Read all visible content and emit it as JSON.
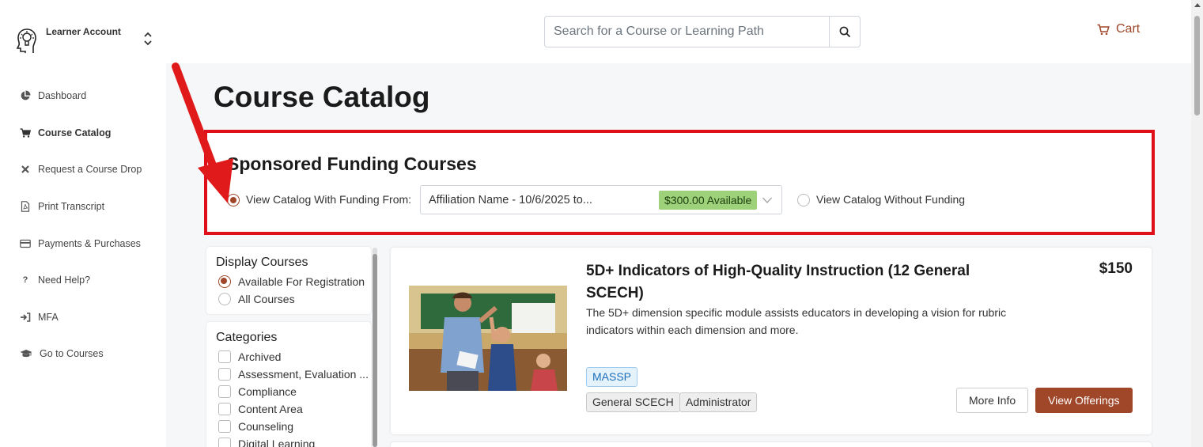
{
  "sidebar": {
    "account_label": "Learner Account",
    "items": [
      {
        "label": "Dashboard",
        "icon": "pie-chart-icon"
      },
      {
        "label": "Course Catalog",
        "icon": "cart-icon",
        "active": true
      },
      {
        "label": "Request a Course Drop",
        "icon": "x-icon"
      },
      {
        "label": "Print Transcript",
        "icon": "pdf-file-icon"
      },
      {
        "label": "Payments & Purchases",
        "icon": "credit-card-icon"
      },
      {
        "label": "Need Help?",
        "icon": "question-icon"
      },
      {
        "label": "MFA",
        "icon": "sign-in-icon"
      },
      {
        "label": "Go to Courses",
        "icon": "graduation-cap-icon"
      }
    ]
  },
  "header": {
    "search_placeholder": "Search for a Course or Learning Path",
    "cart_label": "Cart"
  },
  "page": {
    "title": "Course Catalog"
  },
  "funding": {
    "title": "Sponsored Funding Courses",
    "with_funding_label": "View Catalog With Funding From:",
    "selected_affiliation": "Affiliation Name - 10/6/2025 to...",
    "available_badge": "$300.00 Available",
    "without_funding_label": "View Catalog Without Funding",
    "with_funding_selected": true
  },
  "filters": {
    "display": {
      "title": "Display Courses",
      "options": [
        {
          "label": "Available For Registration",
          "selected": true
        },
        {
          "label": "All Courses",
          "selected": false
        }
      ]
    },
    "categories": {
      "title": "Categories",
      "items": [
        "Archived",
        "Assessment, Evaluation ...",
        "Compliance",
        "Content Area",
        "Counseling",
        "Digital Learning"
      ]
    }
  },
  "course": {
    "title": "5D+ Indicators of High-Quality Instruction (12 General SCECH)",
    "description": "The 5D+ dimension specific module assists educators in developing a vision for rubric indicators within each dimension and more.",
    "price": "$150",
    "provider_tag": "MASSP",
    "tags": [
      "General SCECH",
      "Administrator"
    ],
    "more_info_label": "More Info",
    "view_offerings_label": "View Offerings"
  },
  "colors": {
    "accent": "#a0472a",
    "highlight_border": "#e0101a",
    "badge_green": "#9ed27a"
  }
}
